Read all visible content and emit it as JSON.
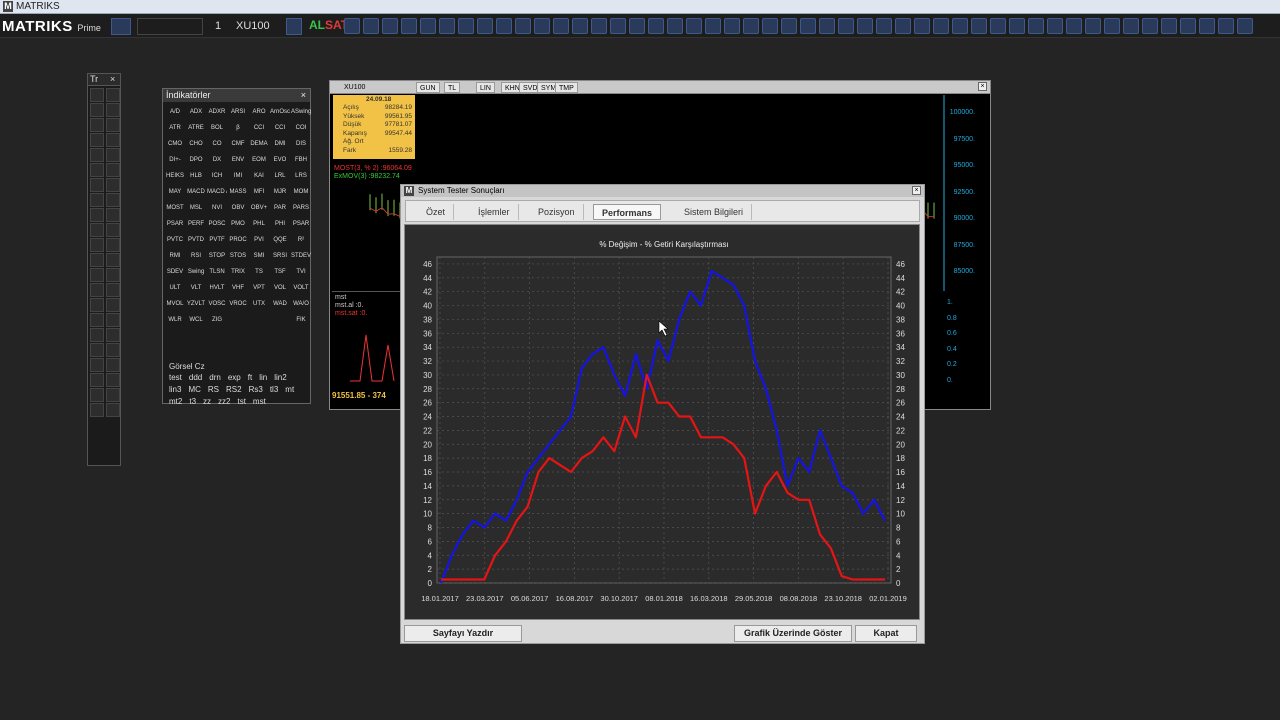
{
  "window": {
    "title": "MATRIKS"
  },
  "toolbar": {
    "logo": "MATRIKS",
    "logo_sub": "Prime",
    "period": "1",
    "symbol": "XU100",
    "al": "AL",
    "sat": "SAT"
  },
  "tools_panel": {
    "title": "Tr"
  },
  "indicators": {
    "title": "İndikatörler",
    "cells": [
      "A/D",
      "ADX",
      "ADXR",
      "ARSI",
      "ARO",
      "ArnOsc",
      "ASwing",
      "ATR",
      "ATRE",
      "BOL",
      "β",
      "CCI",
      "CCI",
      "COI",
      "CMO",
      "CHO",
      "CO",
      "CMF",
      "DEMA",
      "DMI",
      "DIS",
      "DI+-",
      "DPO",
      "DX",
      "ENV",
      "EOM",
      "EVO",
      "FBH",
      "HEIKS",
      "HLB",
      "ICH",
      "IMI",
      "KAI",
      "LRL",
      "LRS",
      "MAY",
      "MACD",
      "MACD A",
      "MASS",
      "MFI",
      "MJR",
      "MOM",
      "MOST",
      "MSL",
      "NVI",
      "OBV",
      "OBV+",
      "PAR",
      "PARS",
      "PSAR",
      "PERF",
      "POSC",
      "PMO",
      "PHL",
      "PHI",
      "PSAR",
      "PVTC",
      "PVTD",
      "PVTF",
      "PROC",
      "PVI",
      "QQE",
      "R²",
      "RMI",
      "RSI",
      "STOP",
      "STOS",
      "SMI",
      "SRSI",
      "STDEV",
      "SDEV",
      "Swing",
      "TLSN",
      "TRIX",
      "TS",
      "TSF",
      "TVI",
      "ULT",
      "VLT",
      "HVLT",
      "VHF",
      "VPT",
      "VOL",
      "VOLT",
      "MVOL",
      "YZVLT",
      "VOSC",
      "VROC",
      "UTX",
      "WAD",
      "WA/O",
      "WLR",
      "WCL",
      "ZIG",
      "",
      "",
      "",
      "FIK",
      "",
      "",
      "",
      "",
      "",
      "",
      "",
      "",
      "",
      "",
      "",
      "",
      "",
      ""
    ],
    "overlay_label": "Görsel Cz",
    "user_items": [
      "test",
      "ddd",
      "drn",
      "exp",
      "ft",
      "lin",
      "lin2",
      "lin3",
      "MC",
      "RS",
      "RS2",
      "Rs3",
      "tl3",
      "mt",
      "mt2",
      "t3",
      "zz",
      "zz2",
      "tst",
      "mst"
    ]
  },
  "price_chart": {
    "symbol": "XU100",
    "tabs": [
      "GUN",
      "TL",
      "LIN",
      "KHN",
      "SVD",
      "SYM",
      "TMP"
    ],
    "info": {
      "date": "24.09.18",
      "rows": [
        {
          "label": "Açılış",
          "value": "98284.19"
        },
        {
          "label": "Yüksek",
          "value": "99561.95"
        },
        {
          "label": "Düşük",
          "value": "97781.07"
        },
        {
          "label": "Kapanış",
          "value": "99547.44"
        },
        {
          "label": "Ağ. Ort",
          "value": ""
        },
        {
          "label": "Fark",
          "value": "1559.28"
        }
      ]
    },
    "legend_most": "MOST(3, % 2) :96064.09",
    "legend_exmov": "ExMOV(3) :98232.74",
    "y_labels": [
      "100000.",
      "97500.",
      "95000.",
      "92500.",
      "90000.",
      "87500.",
      "85000."
    ],
    "sub_legend": [
      "mst",
      "mst.al   :0.",
      "mst.sat  :0."
    ],
    "sub_y_labels": [
      "1.",
      "0.8",
      "0.6",
      "0.4",
      "0.2",
      "0."
    ],
    "bottom_value": "91551.85 - 374"
  },
  "dialog": {
    "title": "System Tester Sonuçları",
    "tabs": [
      "Özet",
      "İşlemler",
      "Pozisyon",
      "Performans",
      "Sistem Bilgileri"
    ],
    "active_tab": "Performans",
    "buttons": {
      "print": "Sayfayı Yazdır",
      "show_on_chart": "Grafik Üzerinde Göster",
      "close": "Kapat"
    }
  },
  "chart_data": {
    "type": "line",
    "title": "% Değişim - % Getiri Karşılaştırması",
    "xlabel": "",
    "ylabel": "",
    "x_ticks": [
      "18.01.2017",
      "23.03.2017",
      "05.06.2017",
      "16.08.2017",
      "30.10.2017",
      "08.01.2018",
      "16.03.2018",
      "29.05.2018",
      "08.08.2018",
      "23.10.2018",
      "02.01.2019"
    ],
    "ylim": [
      0,
      47
    ],
    "y_ticks": [
      0,
      2,
      4,
      6,
      8,
      10,
      12,
      14,
      16,
      18,
      20,
      22,
      24,
      26,
      28,
      30,
      32,
      34,
      36,
      38,
      40,
      42,
      44,
      46
    ],
    "grid": true,
    "legend": "none",
    "series": [
      {
        "color": "#1414e6",
        "values": [
          0,
          4,
          7,
          9,
          8,
          10,
          9,
          12,
          16,
          18,
          20,
          22,
          24,
          31,
          33,
          34,
          30,
          27,
          33,
          28,
          35,
          32,
          38,
          42,
          40,
          45,
          44,
          43,
          40,
          32,
          28,
          22,
          14,
          18,
          16,
          22,
          18,
          14,
          13,
          10,
          12,
          9
        ]
      },
      {
        "color": "#e61414",
        "values": [
          0.5,
          0.5,
          0.5,
          0.5,
          0.5,
          4,
          6,
          9,
          11,
          16,
          18,
          17,
          16,
          18,
          19,
          21,
          19,
          24,
          21,
          30,
          26,
          26,
          24,
          24,
          21,
          21,
          21,
          20,
          18,
          10,
          14,
          16,
          13,
          12,
          12,
          7,
          5,
          1,
          0.5,
          0.5,
          0.5,
          0.5
        ]
      }
    ]
  }
}
